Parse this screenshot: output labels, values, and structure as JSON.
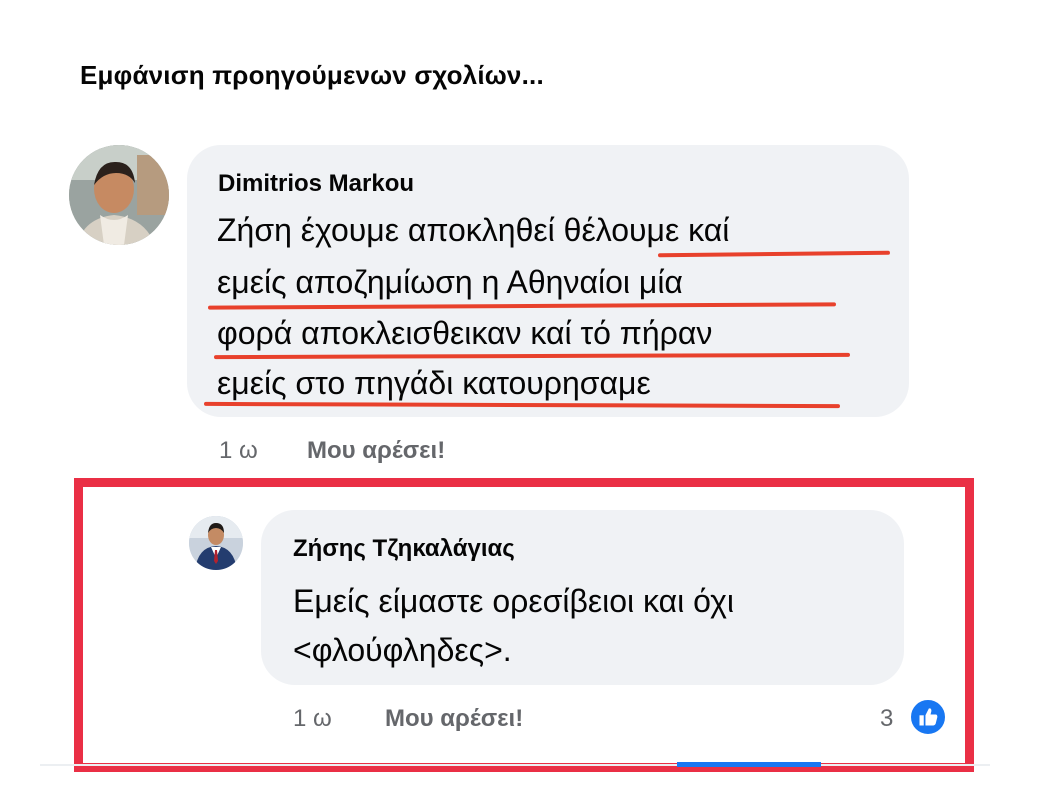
{
  "thread": {
    "see_previous": "Εμφάνιση προηγούμενων σχολίων..."
  },
  "comments": [
    {
      "author": "Dimitrios Markou",
      "lines": [
        "Ζήση έχουμε αποκληθεί θέλουμε καί",
        "εμείς αποζημίωση η Αθηναίοι μία",
        "φορά αποκλεισθεικαν καί τό πήραν",
        "εμείς στο πηγάδι κατουρησαμε"
      ],
      "time": "1 ω",
      "like_label": "Μου αρέσει!",
      "avatar_icon": "man-avatar-photo"
    },
    {
      "author": "Ζήσης Τζηκαλάγιας",
      "lines": [
        "Εμείς είμαστε ορεσίβειοι και όχι",
        "<φλούφληδες>."
      ],
      "time": "1 ω",
      "like_label": "Μου αρέσει!",
      "reaction_count": "3",
      "reaction_icon": "thumbs-up-icon",
      "avatar_icon": "man-in-suit-avatar"
    }
  ],
  "colors": {
    "highlight_frame": "#ea2f45",
    "underline": "#e8412c",
    "bubble_bg": "#f0f2f5",
    "meta_text": "#65676b",
    "facebook_blue": "#1877f2"
  }
}
